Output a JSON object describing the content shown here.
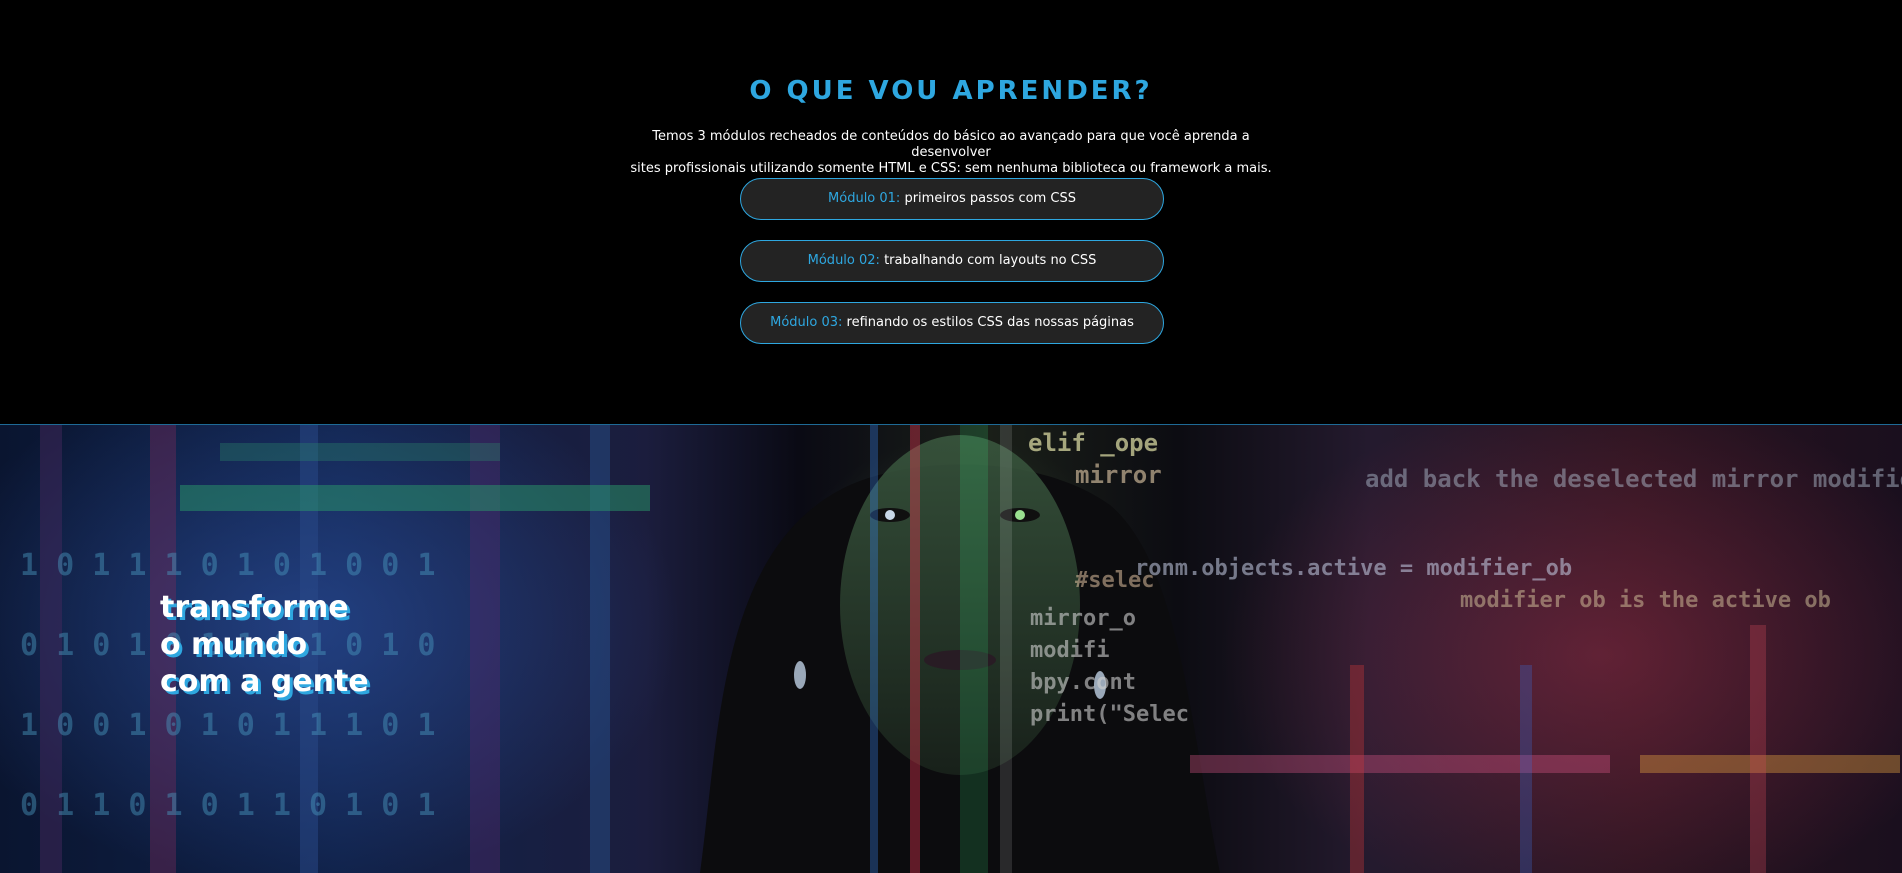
{
  "learn": {
    "title": "O QUE VOU APRENDER?",
    "description_line1": "Temos 3 módulos recheados de conteúdos do básico ao avançado para que você aprenda a desenvolver",
    "description_line2": "sites profissionais utilizando somente HTML e CSS: sem nenhuma biblioteca ou framework a mais.",
    "modules": [
      {
        "prefix": "Módulo 01:",
        "text": "primeiros passos com CSS"
      },
      {
        "prefix": "Módulo 02:",
        "text": "trabalhando com layouts no CSS"
      },
      {
        "prefix": "Módulo 03:",
        "text": "refinando os estilos CSS das nossas páginas"
      }
    ]
  },
  "hero": {
    "line1": "transforme",
    "line2": "o mundo",
    "line3": "com a gente",
    "code_snippets": [
      "elif _ope",
      "mirror",
      "add back the deselected mirror modifier o",
      "ronm.objects.active = modifier_ob",
      "modifier ob is the active ob",
      "mirror_o",
      "modifi",
      "bpy.cont",
      "print(\"Selec",
      "#selec"
    ]
  },
  "colors": {
    "accent": "#2ea7e0",
    "background": "#000000",
    "card_background": "#232323",
    "text": "#ffffff"
  }
}
